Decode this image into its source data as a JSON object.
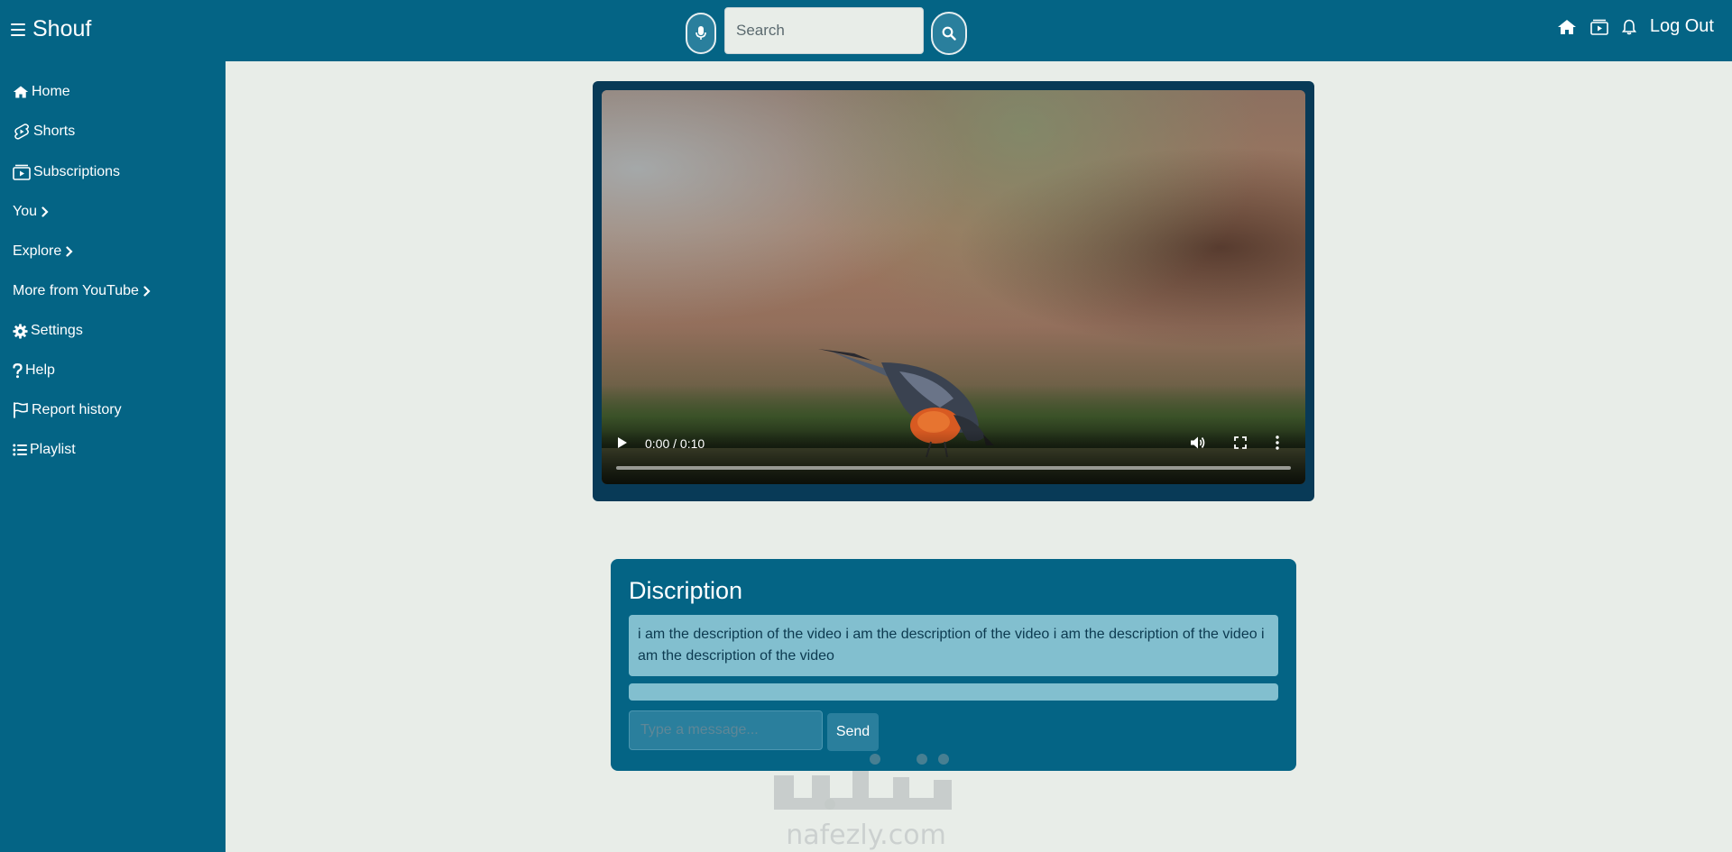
{
  "app": {
    "name": "Shouf"
  },
  "header": {
    "search_placeholder": "Search",
    "logout_label": "Log Out"
  },
  "sidebar": {
    "items": [
      {
        "label": "Home",
        "icon": "home-icon"
      },
      {
        "label": "Shorts",
        "icon": "shorts-icon"
      },
      {
        "label": "Subscriptions",
        "icon": "subscriptions-icon"
      },
      {
        "label": "You",
        "icon": "chevron-right-icon"
      },
      {
        "label": "Explore",
        "icon": "chevron-right-icon"
      },
      {
        "label": "More from YouTube",
        "icon": "chevron-right-icon"
      },
      {
        "label": "Settings",
        "icon": "gear-icon"
      },
      {
        "label": "Help",
        "icon": "question-icon"
      },
      {
        "label": "Report history",
        "icon": "flag-icon"
      },
      {
        "label": "Playlist",
        "icon": "list-icon"
      }
    ]
  },
  "video": {
    "time": "0:00 / 0:10",
    "progress": 0
  },
  "description": {
    "title": "Discription",
    "text": "i am the description of the video i am the description of the video i am the description of the video i am the description of the video",
    "message_placeholder": "Type a message...",
    "send_label": "Send"
  },
  "watermark": {
    "arabic": "نفذلي",
    "domain": "nafezly.com"
  },
  "colors": {
    "primary": "#046485",
    "background": "#e8ede8",
    "video_frame": "#083a57",
    "text_box": "#82bfcf"
  }
}
